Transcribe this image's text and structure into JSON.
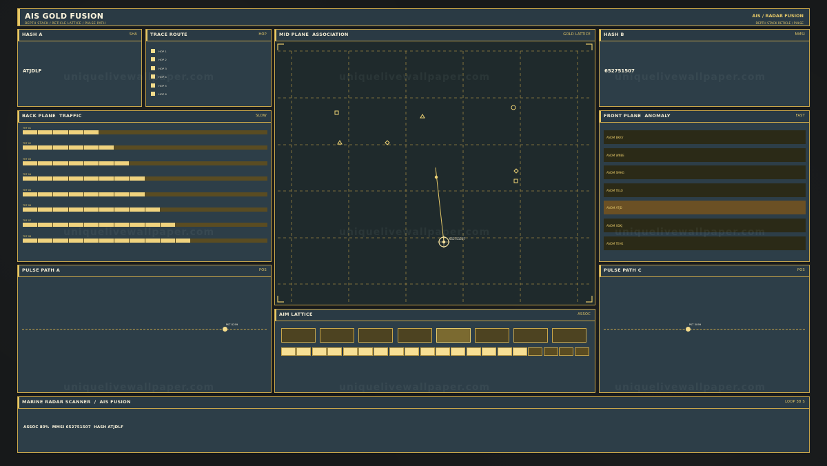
{
  "header": {
    "title": "AIS GOLD FUSION",
    "subtitle": "DEPTH STACK  /  RETICLE LATTICE  /  PULSE PATH",
    "right_title": "AIS / RADAR FUSION",
    "right_sub": "DEPTH STACK  RETICLE / PULSE"
  },
  "hash_a": {
    "title": "HASH A",
    "tag": "SHA",
    "value": "ATJDLF"
  },
  "trace_route": {
    "title": "TRACE ROUTE",
    "tag": "HOP",
    "hops": [
      "HOP 1",
      "HOP 2",
      "HOP 3",
      "HOP 4",
      "HOP 5",
      "HOP 6"
    ]
  },
  "radar": {
    "title": "MID PLANE  ASSOCIATION",
    "tag": "GOLD LATTICE",
    "target_label": "652751507"
  },
  "hash_b": {
    "title": "HASH B",
    "tag": "MMSI",
    "value": "652751507"
  },
  "back_plane": {
    "title": "BACK PLANE  TRAFFIC",
    "tag": "SLOW",
    "rows": [
      {
        "label": "TRF 01",
        "fill": 5
      },
      {
        "label": "TRF 02",
        "fill": 6
      },
      {
        "label": "TRF 03",
        "fill": 7
      },
      {
        "label": "TRF 04",
        "fill": 8
      },
      {
        "label": "TRF 05",
        "fill": 8
      },
      {
        "label": "TRF 06",
        "fill": 9
      },
      {
        "label": "TRF 07",
        "fill": 10
      },
      {
        "label": "TRF 08",
        "fill": 11
      }
    ],
    "segments_total": 16
  },
  "front_plane": {
    "title": "FRONT PLANE  ANOMALY",
    "tag": "FAST",
    "items": [
      {
        "label": "ANOM BKKV",
        "selected": false
      },
      {
        "label": "ANOM WNBE",
        "selected": false
      },
      {
        "label": "ANOM SMHG",
        "selected": false
      },
      {
        "label": "ANOM TELO",
        "selected": false
      },
      {
        "label": "ANOM ATJD",
        "selected": true
      },
      {
        "label": "ANOM XDKJ",
        "selected": false
      },
      {
        "label": "ANOM TEHK",
        "selected": false
      }
    ]
  },
  "pulse_a": {
    "title": "PULSE PATH A",
    "tag": "POS",
    "label": "PKT 8299",
    "position": 0.83
  },
  "pulse_c": {
    "title": "PULSE PATH C",
    "tag": "POS",
    "label": "PKT 3099",
    "position": 0.42
  },
  "aim_lattice": {
    "title": "AIM LATTICE",
    "tag": "ASSOC",
    "cells": 8,
    "selected_cell": 4,
    "segments_total": 20,
    "segments_on": 16
  },
  "status_bar": {
    "title": "MARINE RADAR SCANNER  /  AIS FUSION",
    "tag": "LOOP 38 S",
    "text": "ASSOC 80%  MMSI 652751507  HASH ATJDLF"
  },
  "watermark": "uniquelivewallpaper.com",
  "colors": {
    "gold": "#e5c868",
    "panel": "#2d3e48",
    "radar_bg": "#1f2a2c"
  }
}
